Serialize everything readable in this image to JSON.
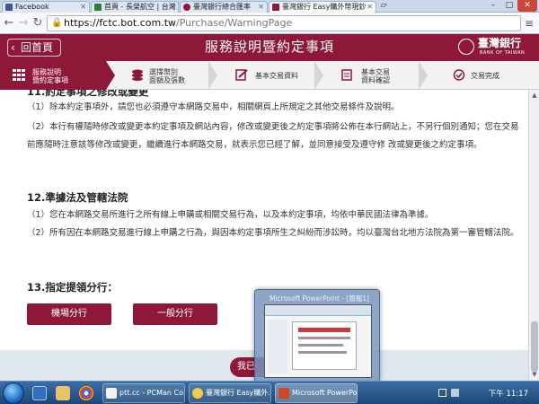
{
  "browser": {
    "tabs": [
      {
        "title": "Facebook",
        "icon_color": "#3b5998"
      },
      {
        "title": "首頁 - 長榮航空 | 台灣",
        "icon_color": "#2e7d32"
      },
      {
        "title": "臺灣銀行總合匯率",
        "icon_color": "#8e1838"
      },
      {
        "title": "臺灣銀行 Easy購外幣現鈔",
        "icon_color": "#8e1838"
      }
    ],
    "url_host": "https://fctc.bot.com.tw",
    "url_path": "/Purchase/WarningPage"
  },
  "header": {
    "home_label": "回首頁",
    "title": "服務說明暨約定事項",
    "logo_zh": "臺灣銀行",
    "logo_en": "BANK OF TAIWAN"
  },
  "steps": [
    {
      "label_1": "服務說明",
      "label_2": "暨約定事項"
    },
    {
      "label_1": "選擇幣別",
      "label_2": "面額及張數"
    },
    {
      "label_1": "基本交易資料",
      "label_2": ""
    },
    {
      "label_1": "基本交易",
      "label_2": "資料確認"
    },
    {
      "label_1": "交易完成",
      "label_2": ""
    }
  ],
  "content": {
    "section11_title": "11.約定事項之修改或變更",
    "s11_p1": "（1）除本約定事項外，請您也必須遵守本網路交易中，相關網頁上所規定之其他交易條件及說明。",
    "s11_p2": "（2）本行有權隨時修改或變更本約定事項及網站內容，修改或變更後之約定事項將公佈在本行網站上，不另行個別通知；您在交易前應隨時注意該等修改或變更，繼續進行本網路交易，就表示您已經了解，並同意接受及遵守修 改或變更後之約定事項。",
    "section12_title": "12.準據法及管轄法院",
    "s12_p1": "（1）您在本網路交易所進行之所有線上申購或相關交易行為，以及本約定事項，均依中華民國法律為準據。",
    "s12_p2": "（2）所有因在本網路交易進行線上申購之行為，與因本約定事項所生之糾紛而涉訟時，均以臺灣台北地方法院為第一審管轄法院。",
    "section13_title": "13.指定提領分行：",
    "branch_button": "機場分行",
    "general_button": "一般分行",
    "next_button": "我已"
  },
  "preview": {
    "title": "Microsoft PowerPoint - [簡報1]"
  },
  "taskbar": {
    "tasks": [
      {
        "label": "ptt.cc - PCMan Co...",
        "icon_color": "#f2f2f2"
      },
      {
        "label": "臺灣銀行 Easy購外...",
        "icon_color": "#f2c94c"
      },
      {
        "label": "Microsoft PowerPoi...",
        "icon_color": "#d24726"
      }
    ],
    "clock": "下午 11:17"
  }
}
